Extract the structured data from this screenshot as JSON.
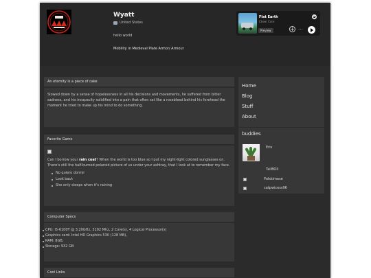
{
  "profile": {
    "name": "Wyatt",
    "location": "United States",
    "bio": "hello world",
    "mood": "Mobility in Medieval Plate Armor/ Armour"
  },
  "spotify": {
    "track": "Flat Earth",
    "artist": "Cheer Core",
    "preview_label": "Preview",
    "add_symbol": "+",
    "more_symbol": "···"
  },
  "colors": {
    "page_bg": "#2b2b2b",
    "box_bg": "#373737",
    "text": "#d8d8d8",
    "avatar_red": "#c8241b"
  },
  "about": {
    "title": "An eternity is a piece of cake",
    "text": "Slowed down by a sense of hopelessness in all his decisions and movements, he suffered from bitter sadness, and his incapacity solidified into a pain that often sat like a rosebleed behind his forehead the moment he tried to make up his mind to do something."
  },
  "favorite_game": {
    "title": "Favorite Game",
    "lyric_before": "Can I borrow your ",
    "lyric_bold": "rain coat",
    "lyric_after": "? When the world is too blue so I put my night-light colored sunglasses on. There's still the half-burned polaroid picture of us under your ashtray, that I look at to remember my face.",
    "list": [
      "No quiero dormir",
      "Look back",
      "She only sleeps when it's raining"
    ]
  },
  "specs": {
    "title": "Computer Specs",
    "items": [
      "CPU: i5-6100T @ 3.20GHz, 3192 Mhz, 2 Core(s), 4 Logical Processor(s)",
      "Graphics card: Intel HD Graphics 530 (128 MB),",
      "RAM: 8GB,",
      "Storage: 932 GB"
    ]
  },
  "cool_links": {
    "title": "Cool Links"
  },
  "nav": {
    "items": [
      "Home",
      "Blog",
      "Stuff",
      "About"
    ]
  },
  "buddies": {
    "title": "buddies",
    "list": [
      "Eris",
      "TailBOll",
      "Polskimese",
      "catpwicess96"
    ]
  }
}
